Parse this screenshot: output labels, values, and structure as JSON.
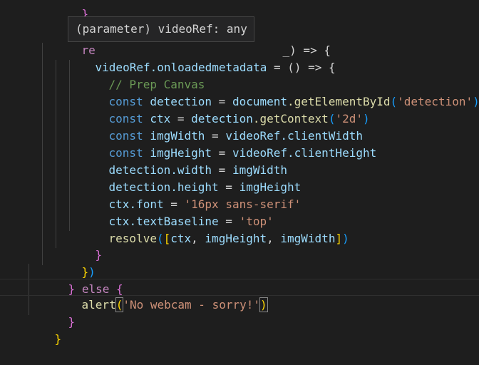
{
  "tooltip": {
    "text": "(parameter) videoRef: any"
  },
  "code": {
    "l0_partial": "re",
    "l0_tail": "_) => {",
    "l1": {
      "obj": "videoRef",
      "prop": ".onloadedmetadata",
      "rest": " = () => {"
    },
    "l2": "// Prep Canvas",
    "l3": {
      "kw": "const",
      "name": " detection",
      "eq": " = ",
      "obj": "document",
      "fn": ".getElementById",
      "arg": "'detection'"
    },
    "l4": {
      "kw": "const",
      "name": " ctx",
      "eq": " = ",
      "obj": "detection",
      "fn": ".getContext",
      "arg": "'2d'"
    },
    "l5": {
      "kw": "const",
      "name": " imgWidth",
      "eq": " = ",
      "obj": "videoRef",
      "prop": ".clientWidth"
    },
    "l6": {
      "kw": "const",
      "name": " imgHeight",
      "eq": " = ",
      "obj": "videoRef",
      "prop": ".clientHeight"
    },
    "l7": {
      "obj": "detection",
      "prop": ".width",
      "eq": " = ",
      "val": "imgWidth"
    },
    "l8": {
      "obj": "detection",
      "prop": ".height",
      "eq": " = ",
      "val": "imgHeight"
    },
    "l9": {
      "obj": "ctx",
      "prop": ".font",
      "eq": " = ",
      "val": "'16px sans-serif'"
    },
    "l10": {
      "obj": "ctx",
      "prop": ".textBaseline",
      "eq": " = ",
      "val": "'top'"
    },
    "l11": {
      "fn": "resolve",
      "a": "ctx",
      "b": "imgHeight",
      "c": "imgWidth"
    },
    "l14": {
      "kw": "else"
    },
    "l15": {
      "fn": "alert",
      "arg": "'No webcam - sorry!'"
    }
  }
}
